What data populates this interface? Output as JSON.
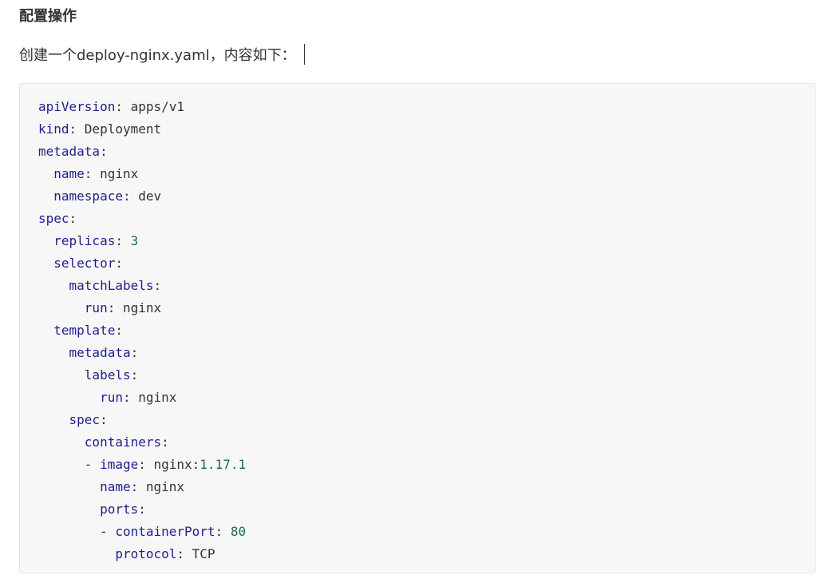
{
  "heading": "配置操作",
  "intro": "创建一个deploy-nginx.yaml，内容如下：",
  "colors": {
    "key": "#1f1f8f",
    "number": "#1d6b4a",
    "text": "#333333",
    "code_background": "#f7f7f7",
    "code_border": "#e6e6e6"
  },
  "code": {
    "language": "yaml",
    "lines": [
      {
        "indent": "",
        "dash": "",
        "key": "apiVersion",
        "value": "apps/v1",
        "num": ""
      },
      {
        "indent": "",
        "dash": "",
        "key": "kind",
        "value": "Deployment",
        "num": ""
      },
      {
        "indent": "",
        "dash": "",
        "key": "metadata",
        "value": "",
        "num": ""
      },
      {
        "indent": "  ",
        "dash": "",
        "key": "name",
        "value": "nginx",
        "num": ""
      },
      {
        "indent": "  ",
        "dash": "",
        "key": "namespace",
        "value": "dev",
        "num": ""
      },
      {
        "indent": "",
        "dash": "",
        "key": "spec",
        "value": "",
        "num": ""
      },
      {
        "indent": "  ",
        "dash": "",
        "key": "replicas",
        "value": "",
        "num": "3"
      },
      {
        "indent": "  ",
        "dash": "",
        "key": "selector",
        "value": "",
        "num": ""
      },
      {
        "indent": "    ",
        "dash": "",
        "key": "matchLabels",
        "value": "",
        "num": ""
      },
      {
        "indent": "      ",
        "dash": "",
        "key": "run",
        "value": "nginx",
        "num": ""
      },
      {
        "indent": "  ",
        "dash": "",
        "key": "template",
        "value": "",
        "num": ""
      },
      {
        "indent": "    ",
        "dash": "",
        "key": "metadata",
        "value": "",
        "num": ""
      },
      {
        "indent": "      ",
        "dash": "",
        "key": "labels",
        "value": "",
        "num": ""
      },
      {
        "indent": "        ",
        "dash": "",
        "key": "run",
        "value": "nginx",
        "num": ""
      },
      {
        "indent": "    ",
        "dash": "",
        "key": "spec",
        "value": "",
        "num": ""
      },
      {
        "indent": "      ",
        "dash": "",
        "key": "containers",
        "value": "",
        "num": ""
      },
      {
        "indent": "      ",
        "dash": "- ",
        "key": "image",
        "value": "nginx:",
        "num": "1.17.1"
      },
      {
        "indent": "        ",
        "dash": "",
        "key": "name",
        "value": "nginx",
        "num": ""
      },
      {
        "indent": "        ",
        "dash": "",
        "key": "ports",
        "value": "",
        "num": ""
      },
      {
        "indent": "        ",
        "dash": "- ",
        "key": "containerPort",
        "value": "",
        "num": "80"
      },
      {
        "indent": "          ",
        "dash": "",
        "key": "protocol",
        "value": "TCP",
        "num": ""
      }
    ]
  }
}
